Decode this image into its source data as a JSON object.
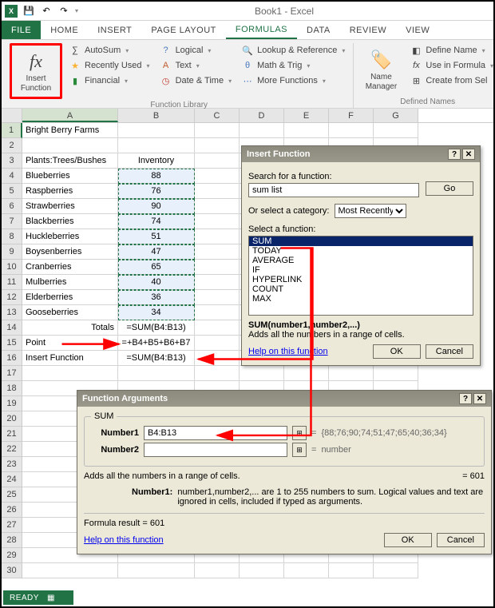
{
  "app": {
    "title": "Book1 - Excel"
  },
  "qat": {
    "save": "💾",
    "undo": "↶",
    "redo": "↷"
  },
  "tabs": [
    "FILE",
    "HOME",
    "INSERT",
    "PAGE LAYOUT",
    "FORMULAS",
    "DATA",
    "REVIEW",
    "VIEW"
  ],
  "ribbon": {
    "insert_fn_label": "Insert\nFunction",
    "fx": "fx",
    "col1": {
      "autosum": "AutoSum",
      "recent": "Recently Used",
      "financial": "Financial"
    },
    "col2": {
      "logical": "Logical",
      "text": "Text",
      "date": "Date & Time"
    },
    "col3": {
      "lookup": "Lookup & Reference",
      "math": "Math & Trig",
      "more": "More Functions"
    },
    "group1_label": "Function Library",
    "name_mgr": "Name\nManager",
    "col4": {
      "define": "Define Name",
      "use": "Use in Formula",
      "create": "Create from Sel"
    },
    "group2_label": "Defined Names"
  },
  "cols": [
    "A",
    "B",
    "C",
    "D",
    "E",
    "F",
    "G"
  ],
  "sheet": {
    "a1": "Bright Berry Farms",
    "a3": "Plants:Trees/Bushes",
    "b3": "Inventory",
    "plants": [
      {
        "name": "Blueberries",
        "qty": 88
      },
      {
        "name": "Raspberries",
        "qty": 76
      },
      {
        "name": "Strawberries",
        "qty": 90
      },
      {
        "name": "Blackberries",
        "qty": 74
      },
      {
        "name": "Huckleberries",
        "qty": 51
      },
      {
        "name": "Boysenberries",
        "qty": 47
      },
      {
        "name": "Cranberries",
        "qty": 65
      },
      {
        "name": "Mulberries",
        "qty": 40
      },
      {
        "name": "Elderberries",
        "qty": 36
      },
      {
        "name": "Gooseberries",
        "qty": 34
      }
    ],
    "a14": "Totals",
    "b14": "=SUM(B4:B13)",
    "a15": "Point",
    "b15": "=+B4+B5+B6+B7",
    "a16": "Insert Function",
    "b16": "=SUM(B4:B13)"
  },
  "insertfn": {
    "title": "Insert Function",
    "search_label": "Search for a function:",
    "search_value": "sum list",
    "go": "Go",
    "category_label": "Or select a category:",
    "category_value": "Most Recently Used",
    "select_label": "Select a function:",
    "fns": [
      "SUM",
      "TODAY",
      "AVERAGE",
      "IF",
      "HYPERLINK",
      "COUNT",
      "MAX"
    ],
    "sig": "SUM(number1,number2,...)",
    "desc": "Adds all the numbers in a range of cells.",
    "help": "Help on this function",
    "ok": "OK",
    "cancel": "Cancel"
  },
  "fnargs": {
    "title": "Function Arguments",
    "fn": "SUM",
    "arg1_label": "Number1",
    "arg1_value": "B4:B13",
    "arg1_preview": "{88;76;90;74;51;47;65;40;36;34}",
    "arg2_label": "Number2",
    "arg2_value": "",
    "arg2_preview": "number",
    "desc1": "Adds all the numbers in a range of cells.",
    "result_eq": "= 601",
    "argdesc_label": "Number1:",
    "argdesc": "number1,number2,... are 1 to 255 numbers to sum. Logical values and text are ignored in cells, included if typed as arguments.",
    "formula_result": "Formula result = 601",
    "help": "Help on this function",
    "ok": "OK",
    "cancel": "Cancel"
  },
  "status": {
    "ready": "READY"
  }
}
